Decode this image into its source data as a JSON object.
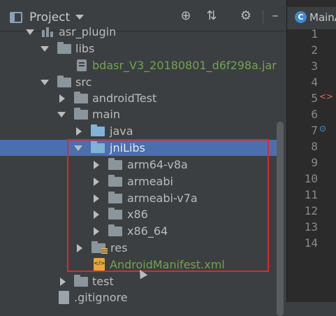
{
  "toolbar": {
    "title": "Project",
    "icons": [
      "locate-icon",
      "collapse-icon",
      "gear-icon",
      "minimize-icon"
    ]
  },
  "tree": [
    {
      "label": "asr_plugin",
      "kind": "module",
      "expanded": true
    },
    {
      "label": "libs",
      "kind": "folder",
      "expanded": true
    },
    {
      "label": "bdasr_V3_20180801_d6f298a.jar",
      "kind": "jar"
    },
    {
      "label": "src",
      "kind": "folder",
      "expanded": true
    },
    {
      "label": "androidTest",
      "kind": "folder",
      "expanded": false
    },
    {
      "label": "main",
      "kind": "folder",
      "expanded": true
    },
    {
      "label": "java",
      "kind": "folder-blue",
      "expanded": false
    },
    {
      "label": "jniLibs",
      "kind": "folder-blue",
      "expanded": true,
      "selected": true
    },
    {
      "label": "arm64-v8a",
      "kind": "folder",
      "expanded": false
    },
    {
      "label": "armeabi",
      "kind": "folder",
      "expanded": false
    },
    {
      "label": "armeabi-v7a",
      "kind": "folder",
      "expanded": false
    },
    {
      "label": "x86",
      "kind": "folder",
      "expanded": false
    },
    {
      "label": "x86_64",
      "kind": "folder",
      "expanded": false
    },
    {
      "label": "res",
      "kind": "folder-res",
      "expanded": false
    },
    {
      "label": "AndroidManifest.xml",
      "kind": "xml"
    },
    {
      "label": "test",
      "kind": "folder",
      "expanded": false
    },
    {
      "label": ".gitignore",
      "kind": "file"
    }
  ],
  "editor": {
    "tab_label": "MainA",
    "tab_letter": "C",
    "line_numbers": [
      "1",
      "2",
      "3",
      "4",
      "5",
      "6",
      "7",
      "8",
      "9",
      "10",
      "11",
      "12",
      "13",
      "14"
    ]
  },
  "colors": {
    "selection": "#4b6eaf",
    "highlight_box": "#e0272b",
    "jar_text": "#72a34f",
    "xml_text": "#72a34f"
  }
}
